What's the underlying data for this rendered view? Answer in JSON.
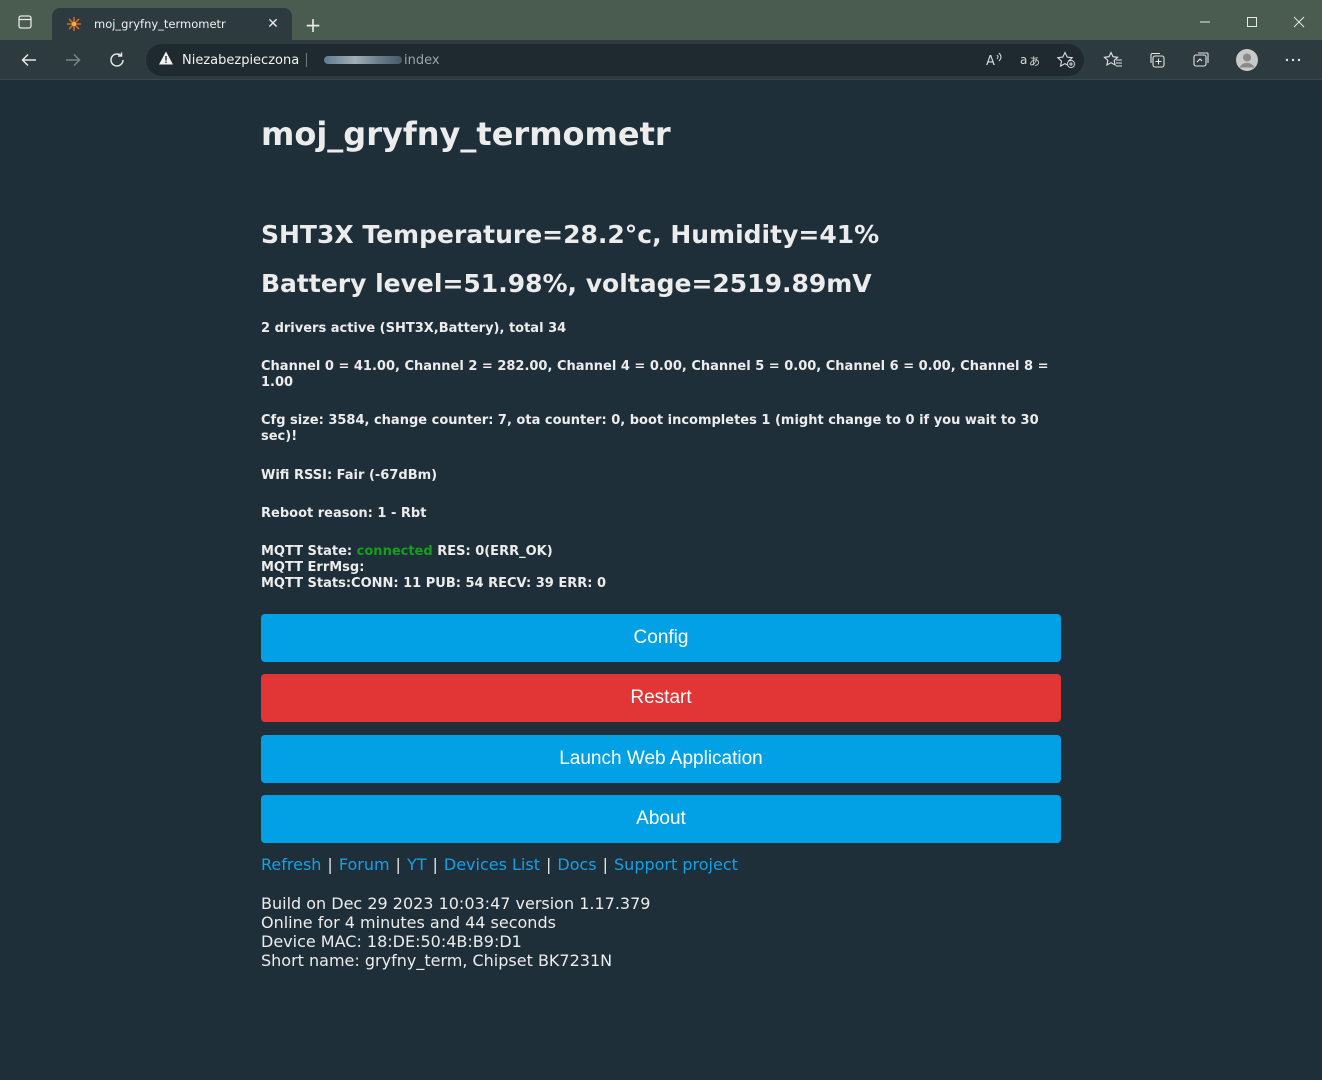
{
  "browser": {
    "tab_title": "moj_gryfny_termometr",
    "security_label": "Niezabezpieczona",
    "url_path": "index"
  },
  "page": {
    "title": "moj_gryfny_termometr",
    "sensor_line": "SHT3X Temperature=28.2°c, Humidity=41%",
    "battery_line": "Battery level=51.98%, voltage=2519.89mV",
    "drivers_line": "2 drivers active (SHT3X,Battery), total 34",
    "channels_line": "Channel 0 = 41.00, Channel 2 = 282.00, Channel 4 = 0.00, Channel 5 = 0.00, Channel 6 = 0.00, Channel 8 = 1.00",
    "cfg_line": "Cfg size: 3584, change counter: 7, ota counter: 0, boot incompletes 1 (might change to 0 if you wait to 30 sec)!",
    "wifi_line": "Wifi RSSI: Fair (-67dBm)",
    "reboot_line": "Reboot reason: 1 - Rbt",
    "mqtt": {
      "state_label": "MQTT State:",
      "state_value": "connected",
      "res": "RES: 0(ERR_OK)",
      "errmsg": "MQTT ErrMsg:",
      "stats": "MQTT Stats:CONN: 11 PUB: 54 RECV: 39 ERR: 0"
    },
    "buttons": {
      "config": "Config",
      "restart": "Restart",
      "launch": "Launch Web Application",
      "about": "About"
    },
    "links": [
      "Refresh",
      "Forum",
      "YT",
      "Devices List",
      "Docs",
      "Support project"
    ],
    "link_separator": "|",
    "footer": {
      "build": "Build on Dec 29 2023 10:03:47 version 1.17.379",
      "online": "Online for 4 minutes and 44 seconds",
      "mac": "Device MAC: 18:DE:50:4B:B9:D1",
      "short_name": "Short name: gryfny_term, Chipset BK7231N"
    }
  },
  "colors": {
    "page_bg": "#1f2f3a",
    "button_blue": "#02a1e6",
    "button_red": "#e23535",
    "link": "#15a0e6",
    "connected": "#12a01b"
  }
}
